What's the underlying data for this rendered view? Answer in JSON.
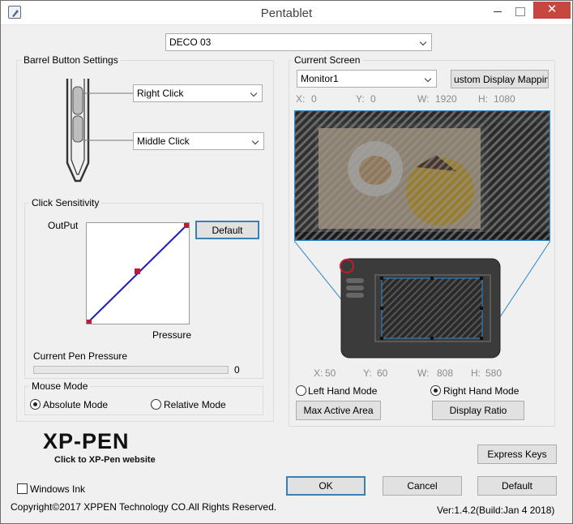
{
  "window": {
    "title": "Pentablet",
    "close_glyph": "✕"
  },
  "device_select": {
    "value": "DECO 03"
  },
  "barrel": {
    "group_label": "Barrel Button Settings",
    "upper_button": "Right Click",
    "lower_button": "Middle Click"
  },
  "sensitivity": {
    "group_label": "Click Sensitivity",
    "output_label": "OutPut",
    "pressure_label": "Pressure",
    "default_button": "Default",
    "current_pressure_label": "Current Pen Pressure",
    "current_pressure_value": "0"
  },
  "mouse_mode": {
    "group_label": "Mouse Mode",
    "absolute": "Absolute Mode",
    "relative": "Relative Mode",
    "selected": "absolute"
  },
  "current_screen": {
    "group_label": "Current Screen",
    "monitor": "Monitor1",
    "custom_mapping_button": "ustom Display Mappin",
    "x_label": "X:",
    "x_value": "0",
    "y_label": "Y:",
    "y_value": "0",
    "w_label": "W:",
    "w_value": "1920",
    "h_label": "H:",
    "h_value": "1080"
  },
  "tablet_area": {
    "x_label": "X:",
    "x_value": "50",
    "y_label": "Y:",
    "y_value": "60",
    "w_label": "W:",
    "w_value": "808",
    "h_label": "H:",
    "h_value": "580",
    "left_hand": "Left Hand Mode",
    "right_hand": "Right Hand Mode",
    "selected_hand": "right",
    "max_active_area_button": "Max Active Area",
    "display_ratio_button": "Display Ratio"
  },
  "brand": {
    "logo": "XP-PEN",
    "link": "Click to XP-Pen website"
  },
  "footer": {
    "express_keys_button": "Express Keys",
    "windows_ink_label": "Windows Ink",
    "ok_button": "OK",
    "cancel_button": "Cancel",
    "default_button": "Default",
    "copyright": "Copyright©2017 XPPEN Technology CO.All Rights Reserved.",
    "version": "Ver:1.4.2(Build:Jan  4 2018)"
  },
  "colors": {
    "close_red": "#c7463f",
    "curve_blue": "#1f1fb8",
    "curve_point": "#c0173a",
    "focus_border": "#3c7fb1"
  }
}
